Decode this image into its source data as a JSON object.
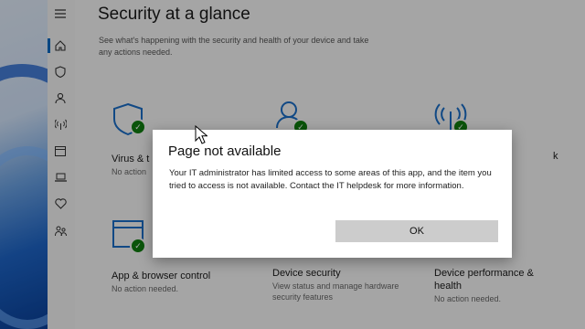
{
  "page": {
    "title": "Security at a glance",
    "subtitle": "See what's happening with the security and health of your device and take any actions needed."
  },
  "nav": {
    "items": [
      "menu-icon",
      "home-icon",
      "shield-icon",
      "person-icon",
      "network-icon",
      "browser-icon",
      "laptop-icon",
      "heart-icon",
      "family-icon"
    ]
  },
  "tiles": {
    "virus": {
      "name": "Virus & t",
      "desc": "No action"
    },
    "account": {
      "name": "",
      "desc": ""
    },
    "firewall": {
      "name": "k",
      "desc": ""
    },
    "app_browser": {
      "name": "App & browser control",
      "desc": "No action needed."
    },
    "device_security": {
      "name": "Device security",
      "desc": "View status and manage hardware security features"
    },
    "device_performance": {
      "name": "Device performance & health",
      "desc": "No action needed."
    }
  },
  "dialog": {
    "title": "Page not available",
    "message": "Your IT administrator has limited access to some areas of this app, and the item you tried to access is not available. Contact the IT helpdesk for more information.",
    "ok_label": "OK"
  },
  "colors": {
    "accent": "#0067c0",
    "ok_green": "#107c10",
    "icon_blue": "#1a6cc4"
  }
}
